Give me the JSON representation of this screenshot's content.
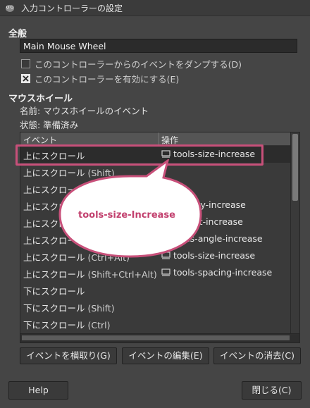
{
  "window": {
    "title": "入力コントローラーの設定",
    "icon": "gimp-icon"
  },
  "general": {
    "section_title": "全般",
    "name_value": "Main Mouse Wheel",
    "dump_events_label": "このコントローラーからのイベントをダンプする(D)",
    "dump_events_checked": false,
    "enable_label": "このコントローラーを有効にする(E)",
    "enable_checked": true
  },
  "mouse_wheel": {
    "section_title": "マウスホイール",
    "name_line": "名前: マウスホイールのイベント",
    "state_line": "状態: 準備済み"
  },
  "table": {
    "col_event": "イベント",
    "col_action": "操作",
    "rows": [
      {
        "event": "上にスクロール",
        "mod": "",
        "action": "tools-size-increase",
        "selected": true
      },
      {
        "event": "上にスクロール",
        "mod": "(Shift)",
        "action": ""
      },
      {
        "event": "上にスクロール",
        "mod": "",
        "action": ""
      },
      {
        "event": "上にスクロール",
        "mod": "",
        "action": "opacity-increase"
      },
      {
        "event": "上にスクロール",
        "mod": "",
        "action": "aspect-increase"
      },
      {
        "event": "上にスクロール",
        "mod": "",
        "action": "tools-angle-increase"
      },
      {
        "event": "上にスクロール",
        "mod": "(Ctrl+Alt)",
        "action": "tools-size-increase"
      },
      {
        "event": "上にスクロール",
        "mod": "(Shift+Ctrl+Alt)",
        "action": "tools-spacing-increase"
      },
      {
        "event": "下にスクロール",
        "mod": "",
        "action": ""
      },
      {
        "event": "下にスクロール",
        "mod": "(Shift)",
        "action": ""
      },
      {
        "event": "下にスクロール",
        "mod": "(Ctrl)",
        "action": ""
      }
    ]
  },
  "callout": {
    "text": "tools-size-Increase",
    "color": "#c8507a"
  },
  "buttons": {
    "grab_event": "イベントを横取り(G)",
    "edit_event": "イベントの編集(E)",
    "clear_event": "イベントの消去(C)",
    "help": "Help",
    "close": "閉じる(C)"
  }
}
